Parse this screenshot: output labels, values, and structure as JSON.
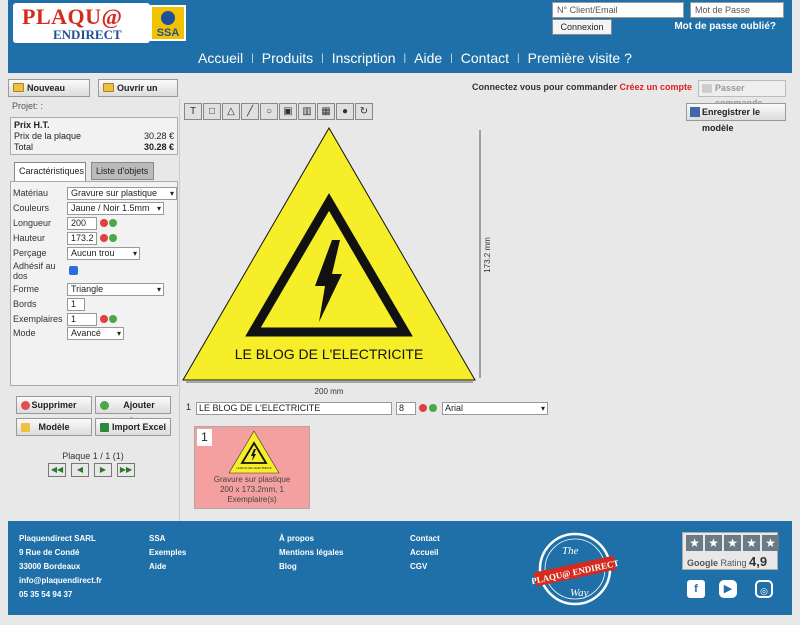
{
  "header": {
    "logo_text_top": "PLAQU@",
    "logo_text_bottom": "ENDIRECT",
    "ssa_label": "SSA",
    "login_placeholder": "N° Client/Email",
    "password_placeholder": "Mot de Passe",
    "connect_button": "Connexion",
    "forgot_link": "Mot de passe oublié?",
    "nav": [
      "Accueil",
      "Produits",
      "Inscription",
      "Aide",
      "Contact",
      "Première visite ?"
    ]
  },
  "toolbar": {
    "new_project": "Nouveau projet",
    "open_project": "Ouvrir un projet",
    "connect_msg": "Connectez vous pour commander",
    "create_account": "Créez un compte",
    "pass_order": "Passer commande",
    "save_model": "Enregistrer le modèle"
  },
  "left": {
    "projet_label": "Projet: :",
    "prix_title": "Prix H.T.",
    "prix_plaque_label": "Prix de la plaque",
    "prix_plaque_value": "30.28 €",
    "total_label": "Total",
    "total_value": "30.28 €",
    "tab_caracteristiques": "Caractéristiques",
    "tab_objets": "Liste d'objets",
    "props": {
      "materiau_label": "Matériau",
      "materiau_value": "Gravure sur plastique",
      "couleurs_label": "Couleurs",
      "couleurs_value": "Jaune / Noir 1.5mm",
      "longueur_label": "Longueur",
      "longueur_value": "200",
      "hauteur_label": "Hauteur",
      "hauteur_value": "173.2",
      "percage_label": "Perçage",
      "percage_value": "Aucun trou",
      "adhesif_label_1": "Adhésif au",
      "adhesif_label_2": "dos",
      "forme_label": "Forme",
      "forme_value": "Triangle",
      "bords_label": "Bords",
      "bords_value": "1",
      "exemplaires_label": "Exemplaires",
      "exemplaires_value": "1",
      "mode_label": "Mode",
      "mode_value": "Avancé"
    },
    "btn_supprimer": "Supprimer",
    "btn_ajouter": "Ajouter plaque",
    "btn_modele": "Modèle",
    "btn_import": "Import Excel",
    "pager_text": "Plaque 1 / 1 (1)"
  },
  "canvas": {
    "sign_text": "LE BLOG DE L'ELECTRICITE",
    "width_label": "200 mm",
    "height_label": "173.2 mm",
    "sign_yellow": "#f7ee2a",
    "sign_black": "#111111"
  },
  "text_line": {
    "index": "1",
    "text": "LE BLOG DE L'ELECTRICITE",
    "size": "8",
    "font": "Arial"
  },
  "thumbnail": {
    "number": "1",
    "caption_1": "Gravure sur plastique",
    "caption_2": "200 x 173.2mm, 1",
    "caption_3": "Exemplaire(s)",
    "mini_text": "LE BLOG DE L'ELECTRICITE"
  },
  "footer": {
    "col1": [
      "Plaquendirect SARL",
      "9 Rue de Condé",
      "33000 Bordeaux",
      "info@plaquendirect.fr",
      "05 35 54 94 37"
    ],
    "col2": [
      "SSA",
      "Exemples",
      "Aide"
    ],
    "col3": [
      "À propos",
      "Mentions légales",
      "Blog"
    ],
    "col4": [
      "Contact",
      "Accueil",
      "CGV"
    ],
    "badge_top": "The",
    "badge_mid": "PLAQU@ ENDIRECT",
    "badge_bottom": "Way",
    "google_word": "Google",
    "rating_word": "Rating",
    "rating_value": "4,9",
    "social": [
      "facebook-icon",
      "youtube-icon",
      "instagram-icon"
    ]
  }
}
